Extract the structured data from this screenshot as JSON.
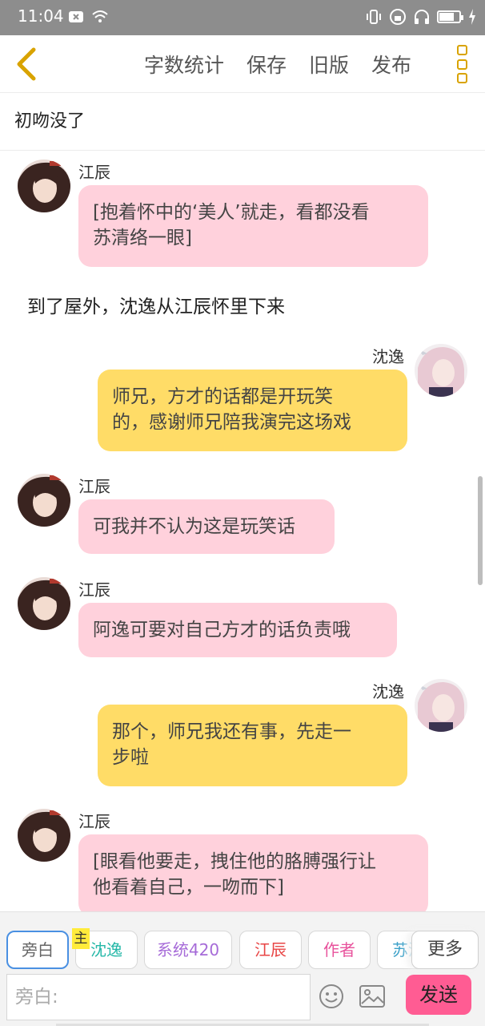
{
  "status_bar": {
    "time": "11:04",
    "left_icons": [
      "close-box-icon",
      "wifi-icon"
    ],
    "right_icons": [
      "vibrate-icon",
      "lock-rotation-icon",
      "headphone-icon",
      "battery-icon",
      "charging-icon"
    ]
  },
  "toolbar": {
    "back_icon": "chevron-left-icon",
    "actions": [
      "字数统计",
      "保存",
      "旧版",
      "发布"
    ],
    "more_icon": "vertical-dots-icon",
    "accent": "#d9a300"
  },
  "story": {
    "title": "初吻没了"
  },
  "messages": [
    {
      "speaker": "江辰",
      "side": "left",
      "color": "#ffd1dc",
      "lines": [
        "[抱着怀中的‘美人’就走，看都没看",
        "苏清络一眼]"
      ]
    },
    {
      "type": "narration",
      "text": "到了屋外，沈逸从江辰怀里下来"
    },
    {
      "speaker": "沈逸",
      "side": "right",
      "color": "#ffdc67",
      "lines": [
        "师兄，方才的话都是开玩笑",
        "的，感谢师兄陪我演完这场戏"
      ]
    },
    {
      "speaker": "江辰",
      "side": "left",
      "color": "#ffd1dc",
      "lines": [
        "可我并不认为这是玩笑话"
      ]
    },
    {
      "speaker": "江辰",
      "side": "left",
      "color": "#ffd1dc",
      "lines": [
        "阿逸可要对自己方才的话负责哦"
      ]
    },
    {
      "speaker": "沈逸",
      "side": "right",
      "color": "#ffdc67",
      "lines": [
        "那个，师兄我还有事，先走一",
        "步啦"
      ]
    },
    {
      "speaker": "江辰",
      "side": "left",
      "color": "#ffd1dc",
      "lines": [
        "[眼看他要走，拽住他的胳膊强行让",
        "他看着自己，一吻而下]"
      ]
    }
  ],
  "composer": {
    "roles": [
      {
        "label": "旁白",
        "color": "#666666"
      },
      {
        "label": "沈逸",
        "color": "#26b8a8"
      },
      {
        "label": "系统420",
        "color": "#a66bd8"
      },
      {
        "label": "江辰",
        "color": "#e84545"
      },
      {
        "label": "作者",
        "color": "#e8529c"
      },
      {
        "label": "苏清",
        "color": "#3aa0c8"
      }
    ],
    "main_badge": "主",
    "more_label": "更多",
    "input_placeholder": "旁白:",
    "emoji_icon": "emoji-icon",
    "image_icon": "image-icon",
    "send_label": "发送",
    "send_color": "#ff5c93"
  }
}
